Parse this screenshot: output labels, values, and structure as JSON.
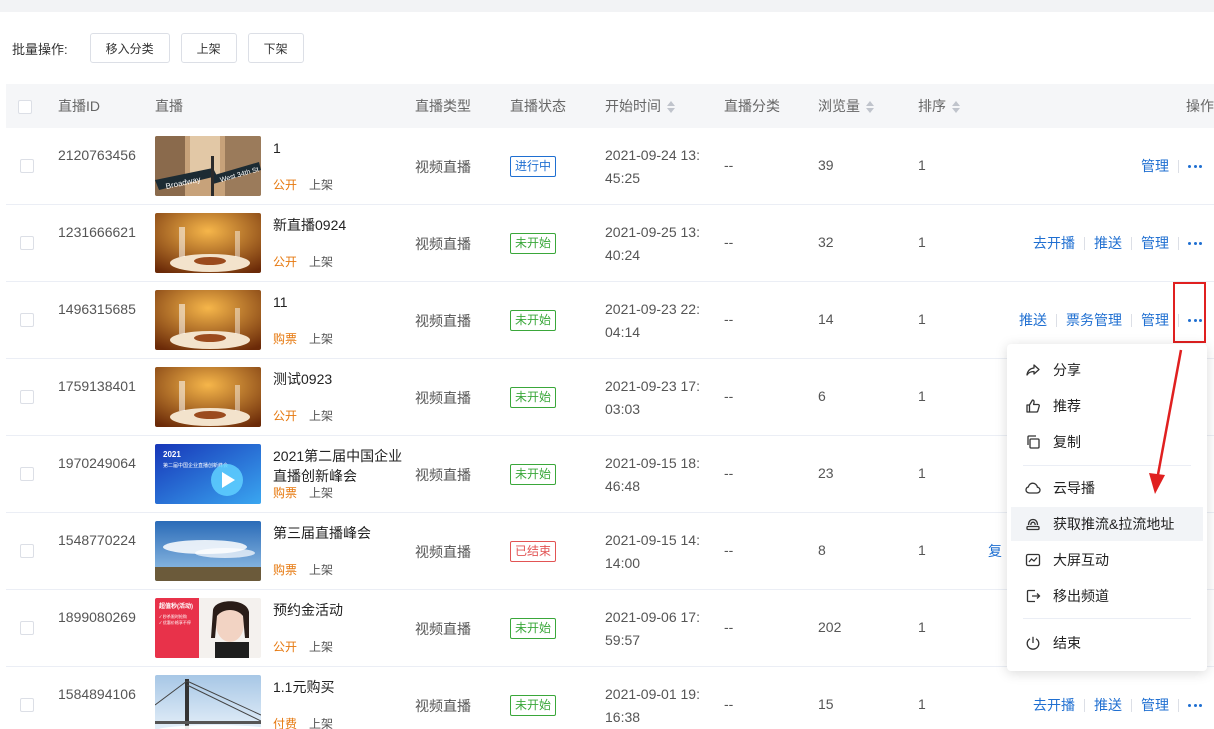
{
  "batch": {
    "label": "批量操作:",
    "move_label": "移入分类",
    "on_label": "上架",
    "off_label": "下架"
  },
  "columns": {
    "id": "直播ID",
    "live": "直播",
    "type": "直播类型",
    "status": "直播状态",
    "start": "开始时间",
    "category": "直播分类",
    "views": "浏览量",
    "sort": "排序",
    "ops": "操作"
  },
  "rows": [
    {
      "id": "2120763456",
      "title": "1",
      "tag": "公开",
      "shelf": "上架",
      "type": "视频直播",
      "status": "进行中",
      "start": "2021-09-24 13:45:25",
      "category": "--",
      "views": "39",
      "sort": "1",
      "actions": [
        "管理"
      ]
    },
    {
      "id": "1231666621",
      "title": "新直播0924",
      "tag": "公开",
      "shelf": "上架",
      "type": "视频直播",
      "status": "未开始",
      "start": "2021-09-25 13:40:24",
      "category": "--",
      "views": "32",
      "sort": "1",
      "actions": [
        "去开播",
        "推送",
        "管理"
      ]
    },
    {
      "id": "1496315685",
      "title": "11",
      "tag": "购票",
      "shelf": "上架",
      "type": "视频直播",
      "status": "未开始",
      "start": "2021-09-23 22:04:14",
      "category": "--",
      "views": "14",
      "sort": "1",
      "actions": [
        "推送",
        "票务管理",
        "管理"
      ]
    },
    {
      "id": "1759138401",
      "title": "测试0923",
      "tag": "公开",
      "shelf": "上架",
      "type": "视频直播",
      "status": "未开始",
      "start": "2021-09-23 17:03:03",
      "category": "--",
      "views": "6",
      "sort": "1",
      "actions": []
    },
    {
      "id": "1970249064",
      "title": "2021第二届中国企业直播创新峰会",
      "tag": "购票",
      "shelf": "上架",
      "type": "视频直播",
      "status": "未开始",
      "start": "2021-09-15 18:46:48",
      "category": "--",
      "views": "23",
      "sort": "1",
      "actions": []
    },
    {
      "id": "1548770224",
      "title": "第三届直播峰会",
      "tag": "购票",
      "shelf": "上架",
      "type": "视频直播",
      "status": "已结束",
      "start": "2021-09-15 14:14:00",
      "category": "--",
      "views": "8",
      "sort": "1",
      "actions": [],
      "cut_action": "复"
    },
    {
      "id": "1899080269",
      "title": "预约金活动",
      "tag": "公开",
      "shelf": "上架",
      "type": "视频直播",
      "status": "未开始",
      "start": "2021-09-06 17:59:57",
      "category": "--",
      "views": "202",
      "sort": "1",
      "actions": []
    },
    {
      "id": "1584894106",
      "title": "1.1元购买",
      "tag": "付费",
      "shelf": "上架",
      "type": "视频直播",
      "status": "未开始",
      "start": "2021-09-01 19:16:38",
      "category": "--",
      "views": "15",
      "sort": "1",
      "actions": [
        "去开播",
        "推送",
        "管理"
      ]
    }
  ],
  "menu": {
    "items": [
      "分享",
      "推荐",
      "复制",
      "云导播",
      "获取推流&拉流地址",
      "大屏互动",
      "移出频道",
      "结束"
    ],
    "icons": [
      "share-icon",
      "thumbs-up-icon",
      "copy-icon",
      "cloud-icon",
      "stream-icon",
      "screen-icon",
      "exit-icon",
      "power-icon"
    ]
  },
  "thumb_text": {
    "street_1": "Broadway",
    "street_2": "West 34th St",
    "summit_year": "2021",
    "summit_caption": "第二届中国企业直播创新峰会",
    "promo_heading": "超值秒(活动)",
    "promo_line_1": "✓ 秒杀限时抢购",
    "promo_line_2": "✓ 优惠价格享不停"
  },
  "colors": {
    "link": "#1f6fd1",
    "tag_orange": "#e6780e",
    "status_live": "#1f6fd1",
    "status_wait": "#3aa73a",
    "status_end": "#e25454",
    "highlight": "#e02020"
  }
}
